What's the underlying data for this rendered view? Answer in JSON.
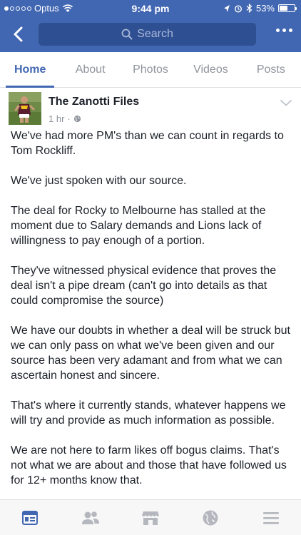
{
  "status_bar": {
    "carrier": "Optus",
    "time": "9:44 pm",
    "battery": "53%",
    "battery_level": 0.53
  },
  "header": {
    "back_icon": "chevron-left-icon",
    "search_placeholder": "Search",
    "more_icon": "more-dots-icon"
  },
  "tabs": [
    {
      "label": "Home",
      "active": true
    },
    {
      "label": "About",
      "active": false
    },
    {
      "label": "Photos",
      "active": false
    },
    {
      "label": "Videos",
      "active": false
    },
    {
      "label": "Posts",
      "active": false
    }
  ],
  "post": {
    "page_name": "The Zanotti Files",
    "time_ago": "1 hr",
    "separator": "·",
    "paragraphs": [
      "We've had more PM's than we can count in regards to Tom Rockliff.",
      "We've just spoken with our source.",
      "The deal for Rocky to Melbourne has stalled at the moment due to Salary demands and Lions lack of willingness to pay enough of a portion.",
      "They've witnessed physical evidence that proves the deal isn't a pipe dream (can't go into details as that could compromise the source)",
      "We have our doubts in whether a deal will be struck but we can only pass on what we've been given and our source has been very adamant and from what we can ascertain honest and sincere.",
      "That's where it currently stands, whatever happens we will try and provide as much information as possible.",
      "We are not here to farm likes off bogus claims. That's not what we are about and those that have followed us for 12+ months know that."
    ]
  },
  "bottom_nav": [
    {
      "icon": "news-feed-icon",
      "active": true
    },
    {
      "icon": "friends-icon",
      "active": false
    },
    {
      "icon": "marketplace-icon",
      "active": false
    },
    {
      "icon": "notifications-globe-icon",
      "active": false
    },
    {
      "icon": "menu-icon",
      "active": false
    }
  ],
  "colors": {
    "brand_blue": "#4267b2",
    "search_bg": "#2f4f93",
    "muted": "#90949c",
    "text": "#1d2129"
  }
}
